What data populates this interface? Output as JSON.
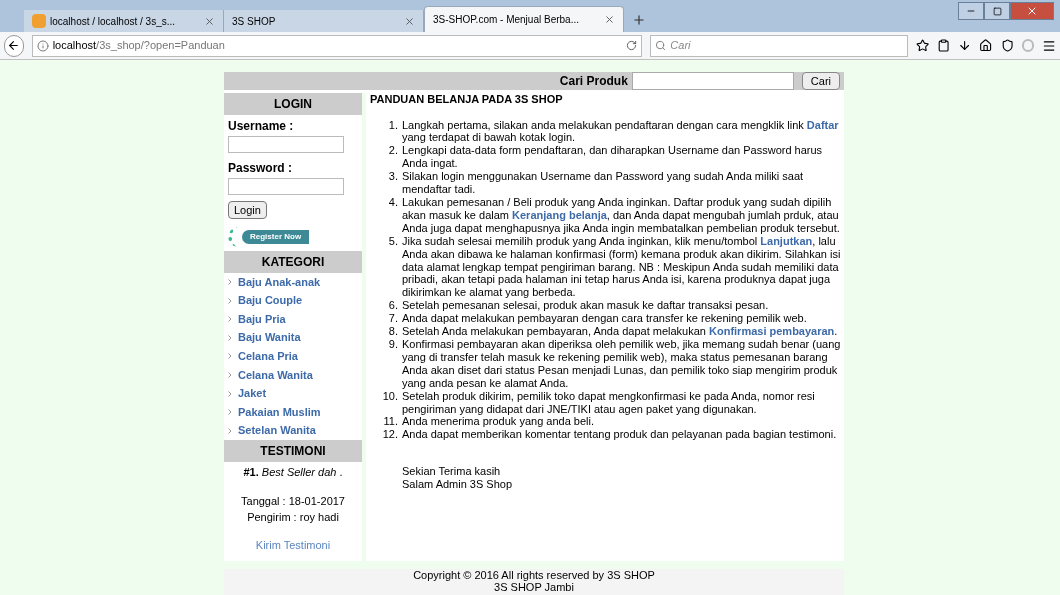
{
  "browser": {
    "tabs": [
      {
        "title": "localhost / localhost / 3s_s...",
        "selected": false,
        "has_icon": true
      },
      {
        "title": "3S SHOP",
        "selected": false,
        "has_icon": false
      },
      {
        "title": "3S-SHOP.com - Menjual Berba...",
        "selected": true,
        "has_icon": false
      }
    ],
    "url_host": "localhost",
    "url_path": "/3s_shop/?open=Panduan",
    "search_placeholder": "Cari"
  },
  "search_bar": {
    "label": "Cari Produk",
    "button": "Cari"
  },
  "login": {
    "title": "LOGIN",
    "username_label": "Username :",
    "password_label": "Password :",
    "button": "Login",
    "register": "Register Now"
  },
  "kategori": {
    "title": "KATEGORI",
    "items": [
      "Baju Anak-anak",
      "Baju Couple",
      "Baju Pria",
      "Baju Wanita",
      "Celana Pria",
      "Celana Wanita",
      "Jaket",
      "Pakaian Muslim",
      "Setelan Wanita"
    ]
  },
  "testimoni": {
    "title": "TESTIMONI",
    "entry": "**#1.** *Best Seller dah* .",
    "date": "Tanggal : 18-01-2017",
    "sender": "Pengirim : roy hadi",
    "link": "Kirim Testimoni"
  },
  "guide": {
    "title": "PANDUAN BELANJA PADA 3S SHOP",
    "numbers": [
      "1.",
      "2.",
      "3.",
      "4.",
      "5.",
      "6.",
      "7.",
      "8.",
      "9.",
      "10.",
      "11.",
      "12."
    ],
    "steps": [
      [
        {
          "text": "Langkah pertama, silakan anda melakukan pendaftaran dengan cara mengklik link ",
          "link": false
        },
        {
          "text": "Daftar",
          "link": true
        },
        {
          "text": " yang terdapat di bawah kotak login.",
          "link": false
        }
      ],
      [
        {
          "text": "Lengkapi data-data form pendaftaran, dan diharapkan Username dan Password harus Anda ingat.",
          "link": false
        }
      ],
      [
        {
          "text": "Silakan login menggunakan Username dan Password yang sudah Anda miliki saat mendaftar tadi.",
          "link": false
        }
      ],
      [
        {
          "text": "Lakukan pemesanan / Beli produk yang Anda inginkan. Daftar produk yang sudah dipilih akan masuk ke dalam ",
          "link": false
        },
        {
          "text": "Keranjang belanja",
          "link": true
        },
        {
          "text": ", dan Anda dapat mengubah jumlah prduk, atau Anda juga dapat menghapusnya jika Anda ingin membatalkan pembelian produk tersebut.",
          "link": false
        }
      ],
      [
        {
          "text": "Jika sudah selesai memilih produk yang Anda inginkan, klik menu/tombol ",
          "link": false
        },
        {
          "text": "Lanjutkan",
          "link": true
        },
        {
          "text": ", lalu Anda akan dibawa ke halaman konfirmasi (form) kemana produk akan dikirim. Silahkan isi data alamat lengkap tempat pengiriman barang. NB : Meskipun Anda sudah memiliki data pribadi, akan tetapi pada halaman ini tetap harus Anda isi, karena produknya dapat juga dikirimkan ke alamat yang berbeda.",
          "link": false
        }
      ],
      [
        {
          "text": "Setelah pemesanan selesai, produk akan masuk ke daftar transaksi pesan.",
          "link": false
        }
      ],
      [
        {
          "text": "Anda dapat melakukan pembayaran dengan cara transfer ke rekening pemilik web.",
          "link": false
        }
      ],
      [
        {
          "text": "Setelah Anda melakukan pembayaran, Anda dapat melakukan ",
          "link": false
        },
        {
          "text": "Konfirmasi pembayaran",
          "link": true
        },
        {
          "text": ".",
          "link": false
        }
      ],
      [
        {
          "text": "Konfirmasi pembayaran akan diperiksa oleh pemilik web, jika memang sudah benar (uang yang di transfer telah masuk ke rekening pemilik web), maka status pemesanan barang Anda akan diset dari status Pesan menjadi Lunas, dan pemilik toko siap mengirim produk yang anda pesan ke alamat Anda.",
          "link": false
        }
      ],
      [
        {
          "text": "Setelah produk dikirim, pemilik toko dapat mengkonfirmasi ke pada Anda, nomor resi pengiriman yang didapat dari JNE/TIKI atau agen paket yang digunakan.",
          "link": false
        }
      ],
      [
        {
          "text": "Anda menerima produk yang anda beli.",
          "link": false
        }
      ],
      [
        {
          "text": "Anda dapat memberikan komentar tentang produk dan pelayanan pada bagian testimoni.",
          "link": false
        }
      ]
    ],
    "closing": [
      "Sekian Terima kasih",
      "Salam Admin 3S Shop"
    ]
  },
  "footer": [
    "Copyright © 2016 All rights reserved by 3S SHOP",
    "3S SHOP Jambi"
  ]
}
